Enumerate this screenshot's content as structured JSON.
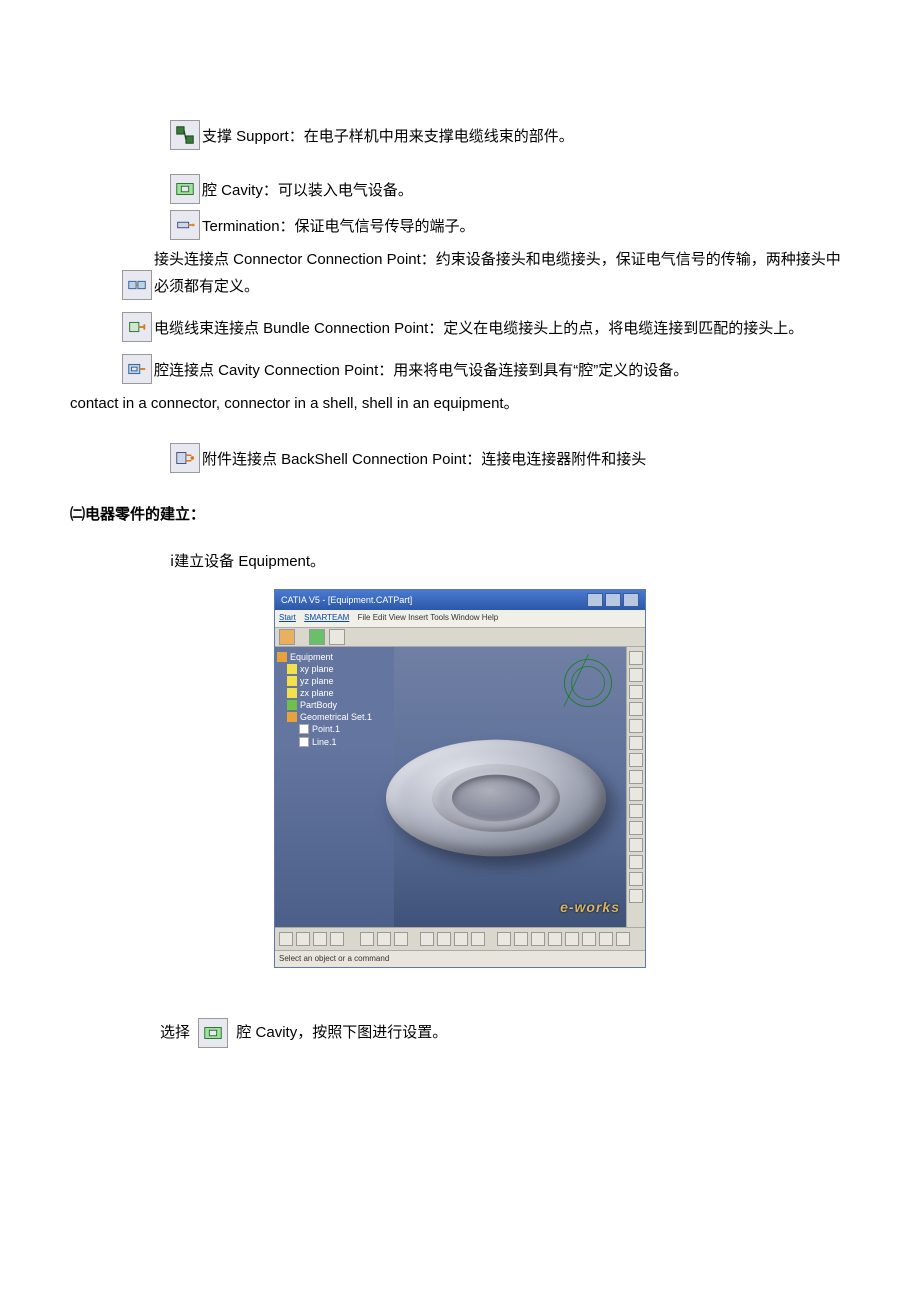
{
  "items": [
    {
      "icon": "support-icon",
      "text": "支撑 Support：在电子样机中用来支撑电缆线束的部件。",
      "indent": true,
      "gapAfter": 18
    },
    {
      "icon": "cavity-icon",
      "text": "腔 Cavity：可以装入电气设备。",
      "indent": true
    },
    {
      "icon": "termination-icon",
      "text": "Termination：保证电气信号传导的端子。",
      "indent": true
    },
    {
      "icon": "connector-cp-icon",
      "text": "接头连接点 Connector Connection Point：约束设备接头和电缆接头，保证电气信号的传输，两种接头中必须都有定义。",
      "indent": false,
      "gapAfter": 6
    },
    {
      "icon": "bundle-cp-icon",
      "text": "电缆线束连接点 Bundle Connection Point：定义在电缆接头上的点，将电缆连接到匹配的接头上。",
      "indent": false,
      "gapAfter": 6
    },
    {
      "icon": "cavity-cp-icon",
      "text": "腔连接点 Cavity Connection Point：用来将电气设备连接到具有“腔”定义的设备。",
      "indent": false
    }
  ],
  "extra_line": "contact in a connector, connector in a shell, shell in an equipment。",
  "backshell": {
    "text": "附件连接点 BackShell Connection Point：连接电连接器附件和接头"
  },
  "section_heading": "㈡电器零件的建立：",
  "step_i": "ⅰ建立设备 Equipment。",
  "catia": {
    "title": "CATIA V5 - [Equipment.CATPart]",
    "menu": {
      "start": "Start",
      "smartteam": "SMARTEAM",
      "rest": "File  Edit  View  Insert  Tools  Window  Help"
    },
    "tree": [
      "Equipment",
      "xy plane",
      "yz plane",
      "zx plane",
      "PartBody",
      "Geometrical Set.1",
      "Point.1",
      "Line.1"
    ],
    "status": "Select an object or a command",
    "watermark": "e-works"
  },
  "select_line": {
    "prefix": "选择",
    "suffix": "腔 Cavity，按照下图进行设置。"
  }
}
